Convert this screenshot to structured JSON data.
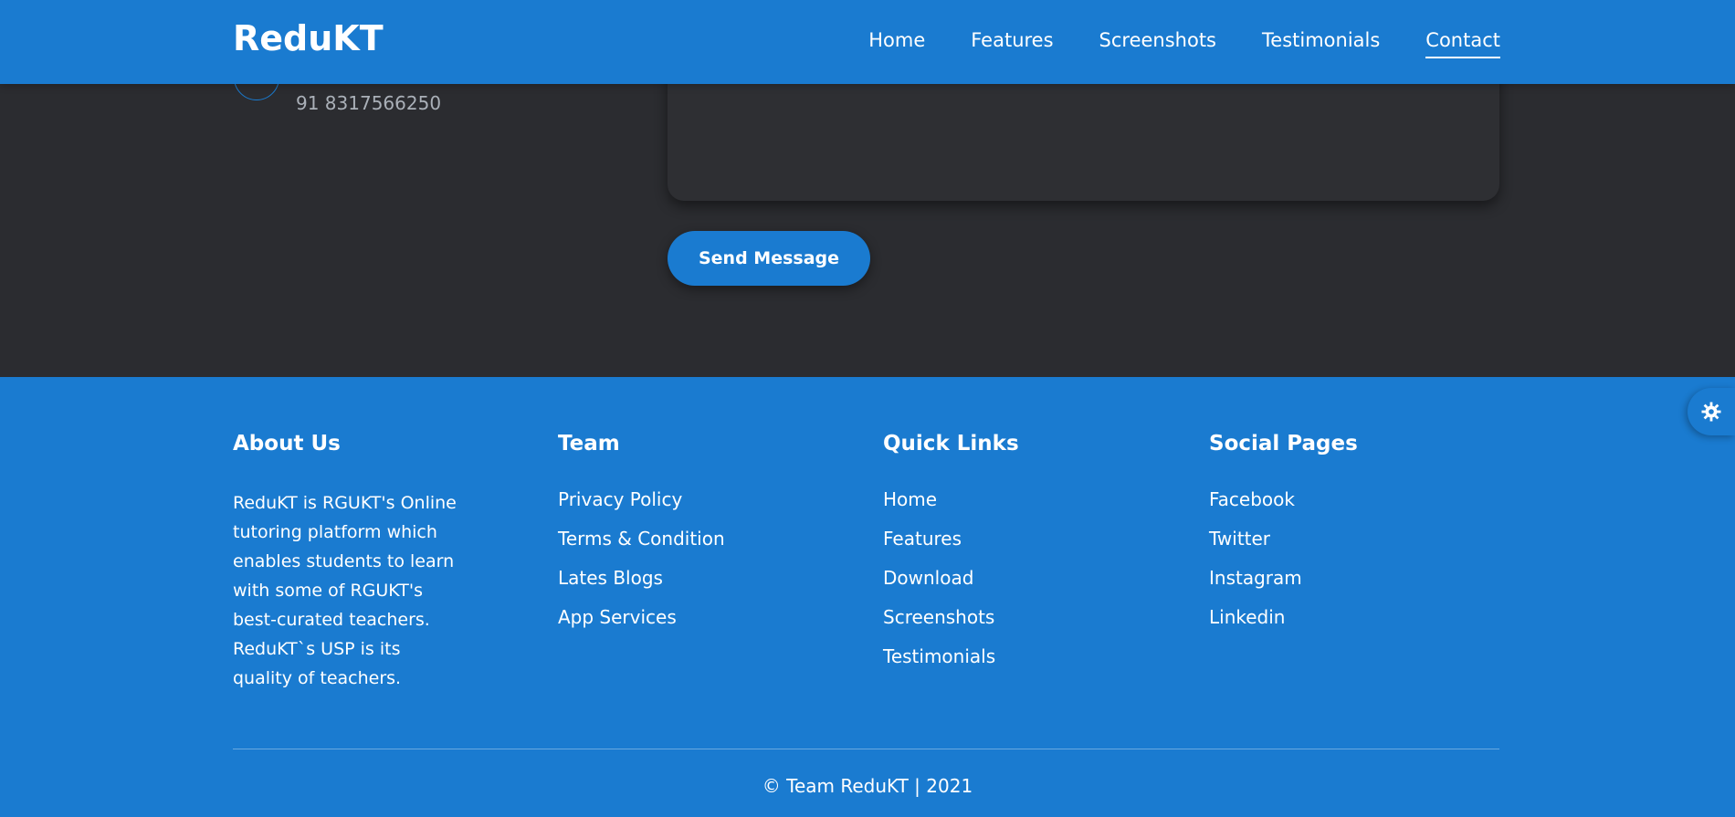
{
  "navbar": {
    "brand": "ReduKT",
    "links": [
      "Home",
      "Features",
      "Screenshots",
      "Testimonials",
      "Contact"
    ],
    "active": "Contact"
  },
  "contact": {
    "phone": "91 8317566250",
    "send_label": "Send Message"
  },
  "footer": {
    "about": {
      "title": "About Us",
      "text": "ReduKT is RGUKT's Online tutoring platform which enables students to learn with some of RGUKT's best-curated teachers. ReduKT`s USP is its quality of teachers."
    },
    "team": {
      "title": "Team",
      "links": [
        "Privacy Policy",
        "Terms & Condition",
        "Lates Blogs",
        "App Services"
      ]
    },
    "quick_links": {
      "title": "Quick Links",
      "links": [
        "Home",
        "Features",
        "Download",
        "Screenshots",
        "Testimonials"
      ]
    },
    "social": {
      "title": "Social Pages",
      "links": [
        "Facebook",
        "Twitter",
        "Instagram",
        "Linkedin"
      ]
    },
    "copyright": "© Team ReduKT | 2021"
  },
  "theme_toggle": {
    "icon": "gear-icon"
  },
  "colors": {
    "primary": "#1a7bd0",
    "dark_bg": "#2b2c30",
    "text_light": "#ffffff",
    "text_muted": "#aab0b8"
  }
}
